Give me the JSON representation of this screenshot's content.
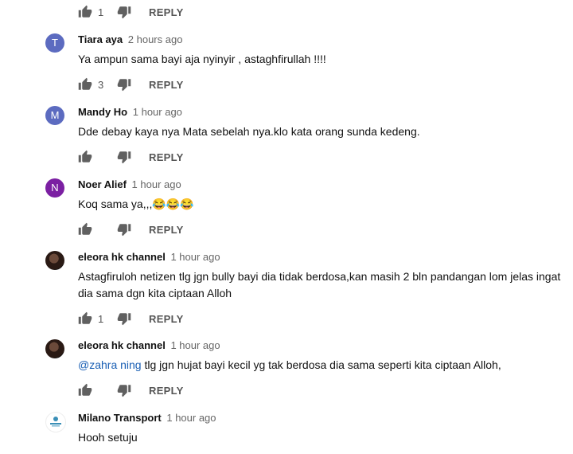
{
  "comments": [
    {
      "author": "",
      "time": "",
      "text": "",
      "likes": "1",
      "reply_label": "REPLY"
    },
    {
      "author": "Tiara aya",
      "time": "2 hours ago",
      "text": "Ya ampun sama bayi aja nyinyir , astaghfirullah !!!!",
      "likes": "3",
      "reply_label": "REPLY",
      "avatar_letter": "T",
      "avatar_color": "#5c6bc0"
    },
    {
      "author": "Mandy Ho",
      "time": "1 hour ago",
      "text": "Dde debay kaya nya Mata sebelah nya.klo kata orang sunda kedeng.",
      "likes": "",
      "reply_label": "REPLY",
      "avatar_letter": "M",
      "avatar_color": "#5c6bc0"
    },
    {
      "author": "Noer Alief",
      "time": "1 hour ago",
      "text": "Koq sama ya,,,😂😂😂",
      "likes": "",
      "reply_label": "REPLY",
      "avatar_letter": "N",
      "avatar_color": "#7b1fa2"
    },
    {
      "author": "eleora hk channel",
      "time": "1 hour ago",
      "text": "Astagfiruloh netizen tlg jgn bully bayi dia tidak berdosa,kan masih 2 bln pandangan lom jelas ingat dia sama dgn kita ciptaan Alloh",
      "likes": "1",
      "reply_label": "REPLY"
    },
    {
      "author": "eleora hk channel",
      "time": "1 hour ago",
      "mention": "@zahra ning",
      "text": " tlg jgn hujat bayi kecil yg tak berdosa dia sama seperti kita ciptaan Alloh,",
      "likes": "",
      "reply_label": "REPLY"
    },
    {
      "author": "Milano Transport",
      "time": "1 hour ago",
      "text": "Hooh setuju",
      "avatar_letter": "MILANO",
      "avatar_color": "#3a8fb7"
    }
  ],
  "icons": {
    "like": "thumbs-up-icon",
    "dislike": "thumbs-down-icon"
  }
}
